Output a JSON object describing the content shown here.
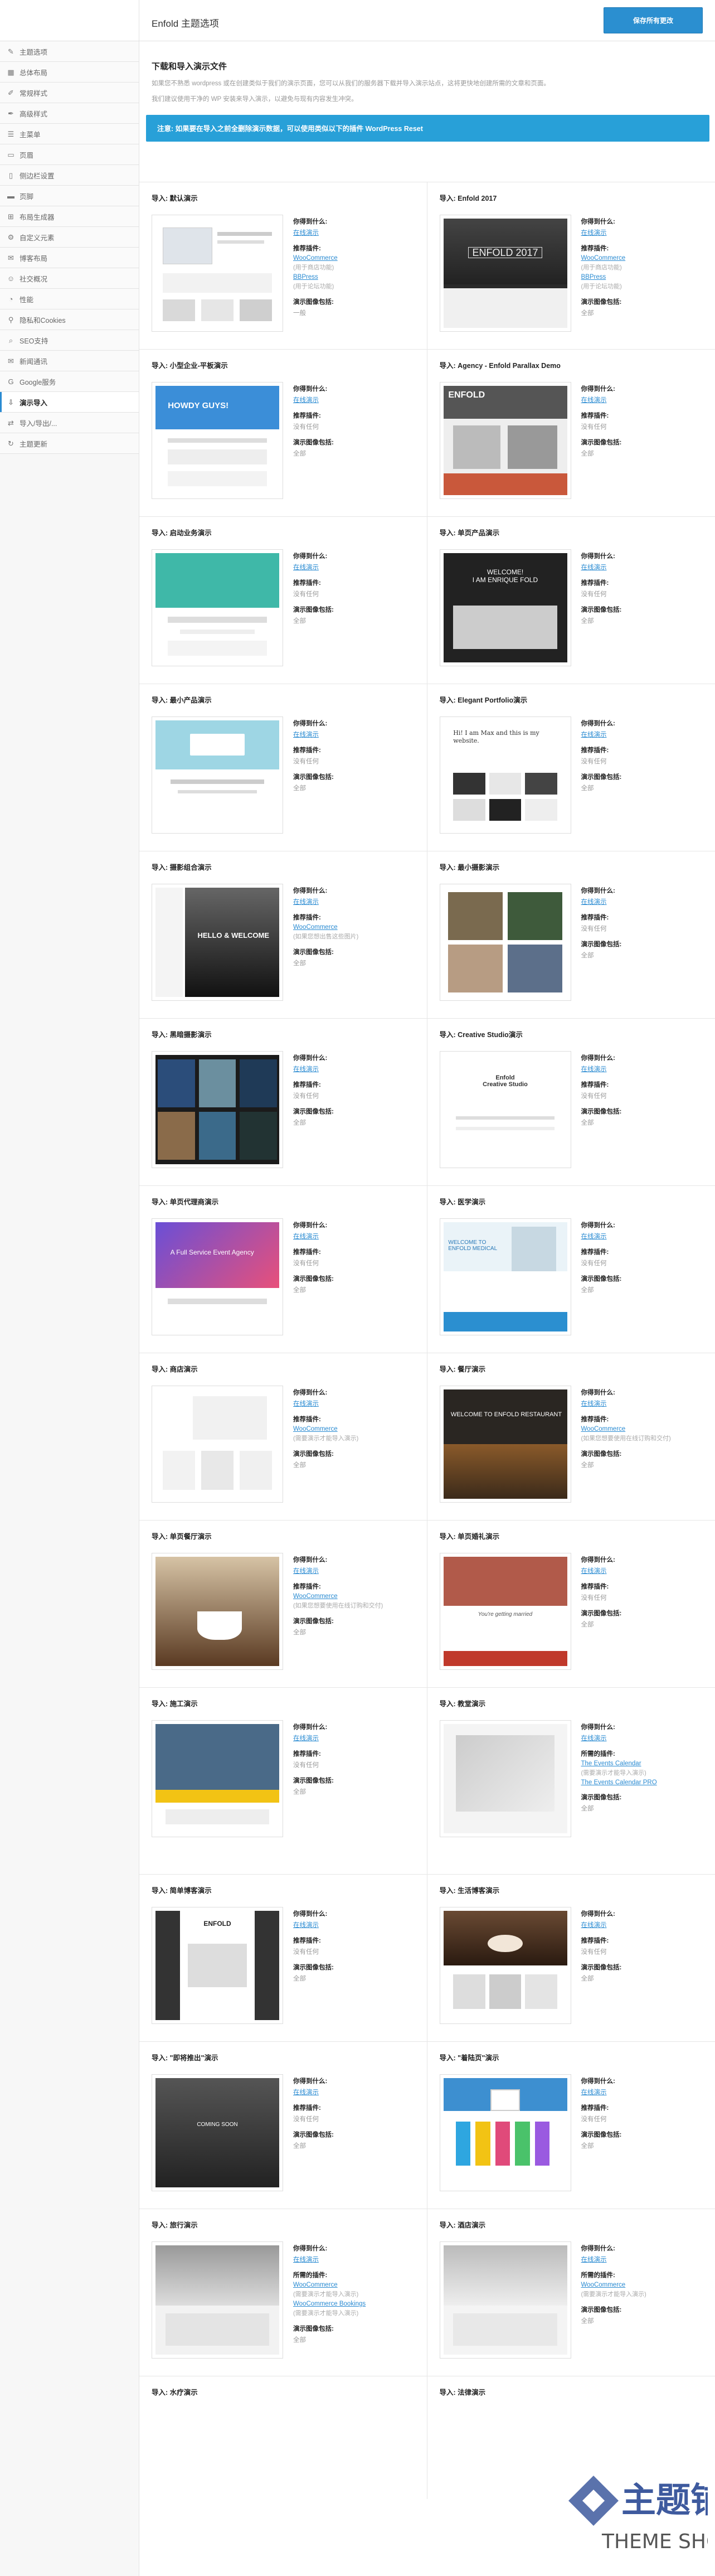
{
  "header": {
    "title": "Enfold 主题选项",
    "save_label": "保存所有更改"
  },
  "sidebar": {
    "items": [
      {
        "label": "主题选项",
        "icon": "wrench-icon"
      },
      {
        "label": "总体布局",
        "icon": "layout-icon"
      },
      {
        "label": "常规样式",
        "icon": "brush-icon"
      },
      {
        "label": "高级样式",
        "icon": "pen-icon"
      },
      {
        "label": "主菜单",
        "icon": "menu-icon"
      },
      {
        "label": "页眉",
        "icon": "header-icon"
      },
      {
        "label": "侧边栏设置",
        "icon": "sidebar-icon"
      },
      {
        "label": "页脚",
        "icon": "footer-icon"
      },
      {
        "label": "布局生成器",
        "icon": "builder-icon"
      },
      {
        "label": "自定义元素",
        "icon": "element-icon"
      },
      {
        "label": "博客布局",
        "icon": "blog-icon"
      },
      {
        "label": "社交概况",
        "icon": "social-icon"
      },
      {
        "label": "性能",
        "icon": "performance-icon"
      },
      {
        "label": "隐私和Cookies",
        "icon": "privacy-icon"
      },
      {
        "label": "SEO支持",
        "icon": "seo-icon"
      },
      {
        "label": "新闻通讯",
        "icon": "newsletter-icon"
      },
      {
        "label": "Google服务",
        "icon": "google-icon"
      },
      {
        "label": "演示导入",
        "icon": "import-icon",
        "active": true
      },
      {
        "label": "导入/导出/...",
        "icon": "export-icon"
      },
      {
        "label": "主题更新",
        "icon": "update-icon"
      }
    ]
  },
  "intro": {
    "heading": "下载和导入演示文件",
    "p1": "如果您不熟悉 wordpress 或在创建类似于我们的演示页面，您可以从我们的服务器下载并导入演示站点，这将更快地创建所需的文章和页面。",
    "p2": "我们建议使用干净的 WP 安装来导入演示，以避免与现有内容发生冲突。",
    "notice": "注意: 如果要在导入之前全删除演示数据，可以使用类似以下的插件 WordPress Reset"
  },
  "labels": {
    "what": "你得到什么:",
    "link": "在线演示",
    "recommended": "推荐插件:",
    "required": "所需的插件:",
    "includes": "演示图像包括:",
    "none": "没有任何",
    "all": "全部",
    "one": "一般"
  },
  "demos": [
    {
      "title": "导入: 默认演示",
      "plugins": [
        "WooCommerce",
        "(用于商店功能)",
        "BBPress",
        "(用于论坛功能)"
      ],
      "images": "一般",
      "theme": "default"
    },
    {
      "title": "导入: Enfold 2017",
      "plugins": [
        "WooCommerce",
        "(用于商店功能)",
        "BBPress",
        "(用于论坛功能)"
      ],
      "images": "全部",
      "theme": "dark2017"
    },
    {
      "title": "导入: 小型企业-平板演示",
      "plugins": [],
      "images": "全部",
      "theme": "blue"
    },
    {
      "title": "导入: Agency - Enfold Parallax Demo",
      "plugins": [],
      "images": "全部",
      "theme": "parallax"
    },
    {
      "title": "导入: 启动业务演示",
      "plugins": [],
      "images": "全部",
      "theme": "teal"
    },
    {
      "title": "导入: 单页产品演示",
      "plugins": [],
      "images": "全部",
      "theme": "darkwelcome"
    },
    {
      "title": "导入: 最小产品演示",
      "plugins": [],
      "images": "全部",
      "theme": "minprod"
    },
    {
      "title": "导入: Elegant Portfolio演示",
      "plugins": [],
      "images": "全部",
      "theme": "elegant"
    },
    {
      "title": "导入: 摄影组合演示",
      "plugins": [
        "WooCommerce",
        "(如果您想出售这些图片)"
      ],
      "images": "全部",
      "theme": "photo"
    },
    {
      "title": "导入: 最小摄影演示",
      "plugins": [],
      "images": "全部",
      "theme": "minphoto"
    },
    {
      "title": "导入: 黑暗摄影演示",
      "plugins": [],
      "images": "全部",
      "theme": "darkphoto"
    },
    {
      "title": "导入: Creative Studio演示",
      "plugins": [],
      "images": "全部",
      "theme": "creative"
    },
    {
      "title": "导入: 单页代理商演示",
      "plugins": [],
      "images": "全部",
      "theme": "agency"
    },
    {
      "title": "导入: 医学演示",
      "plugins": [],
      "images": "全部",
      "theme": "medical"
    },
    {
      "title": "导入: 商店演示",
      "plugins": [
        "WooCommerce",
        "(需要演示才能导入演示)"
      ],
      "images": "全部",
      "theme": "shop"
    },
    {
      "title": "导入: 餐厅演示",
      "plugins": [
        "WooCommerce",
        "(如果您想要使用在线订购和交付)"
      ],
      "images": "全部",
      "theme": "restaurant"
    },
    {
      "title": "导入: 单页餐厅演示",
      "plugins": [
        "WooCommerce",
        "(如果您想要使用在线订购和交付)"
      ],
      "images": "全部",
      "theme": "coffee"
    },
    {
      "title": "导入: 单页婚礼演示",
      "plugins": [],
      "images": "全部",
      "theme": "wedding"
    },
    {
      "title": "导入: 施工演示",
      "plugins": [],
      "images": "全部",
      "theme": "construction"
    },
    {
      "title": "导入: 教堂演示",
      "plugins": [
        "The Events Calendar",
        "(需要演示才能导入演示)",
        "The Events Calendar PRO"
      ],
      "images": "全部",
      "theme": "church",
      "required": true
    },
    {
      "title": "导入: 简单博客演示",
      "plugins": [],
      "images": "全部",
      "theme": "simpleblog"
    },
    {
      "title": "导入: 生活博客演示",
      "plugins": [],
      "images": "全部",
      "theme": "lifestyle"
    },
    {
      "title": "导入: \"即将推出\"演示",
      "plugins": [],
      "images": "全部",
      "theme": "comingsoon"
    },
    {
      "title": "导入: \"着陆页\"演示",
      "plugins": [],
      "images": "全部",
      "theme": "landing"
    },
    {
      "title": "导入: 旅行演示",
      "plugins": [
        "WooCommerce",
        "(需要演示才能导入演示)",
        "WooCommerce Bookings",
        "(需要演示才能导入演示)"
      ],
      "images": "全部",
      "theme": "travel",
      "required": true
    },
    {
      "title": "导入: 酒店演示",
      "plugins": [
        "WooCommerce",
        "(需要演示才能导入演示)"
      ],
      "images": "全部",
      "theme": "hotel",
      "required": true
    },
    {
      "title": "导入: 水疗演示",
      "plugins": [],
      "images": "",
      "theme": "spa"
    },
    {
      "title": "导入: 法律演示",
      "plugins": [],
      "images": "",
      "theme": "law"
    }
  ],
  "watermark": {
    "main": "主题铺",
    "sub": "THEME SHOP"
  }
}
